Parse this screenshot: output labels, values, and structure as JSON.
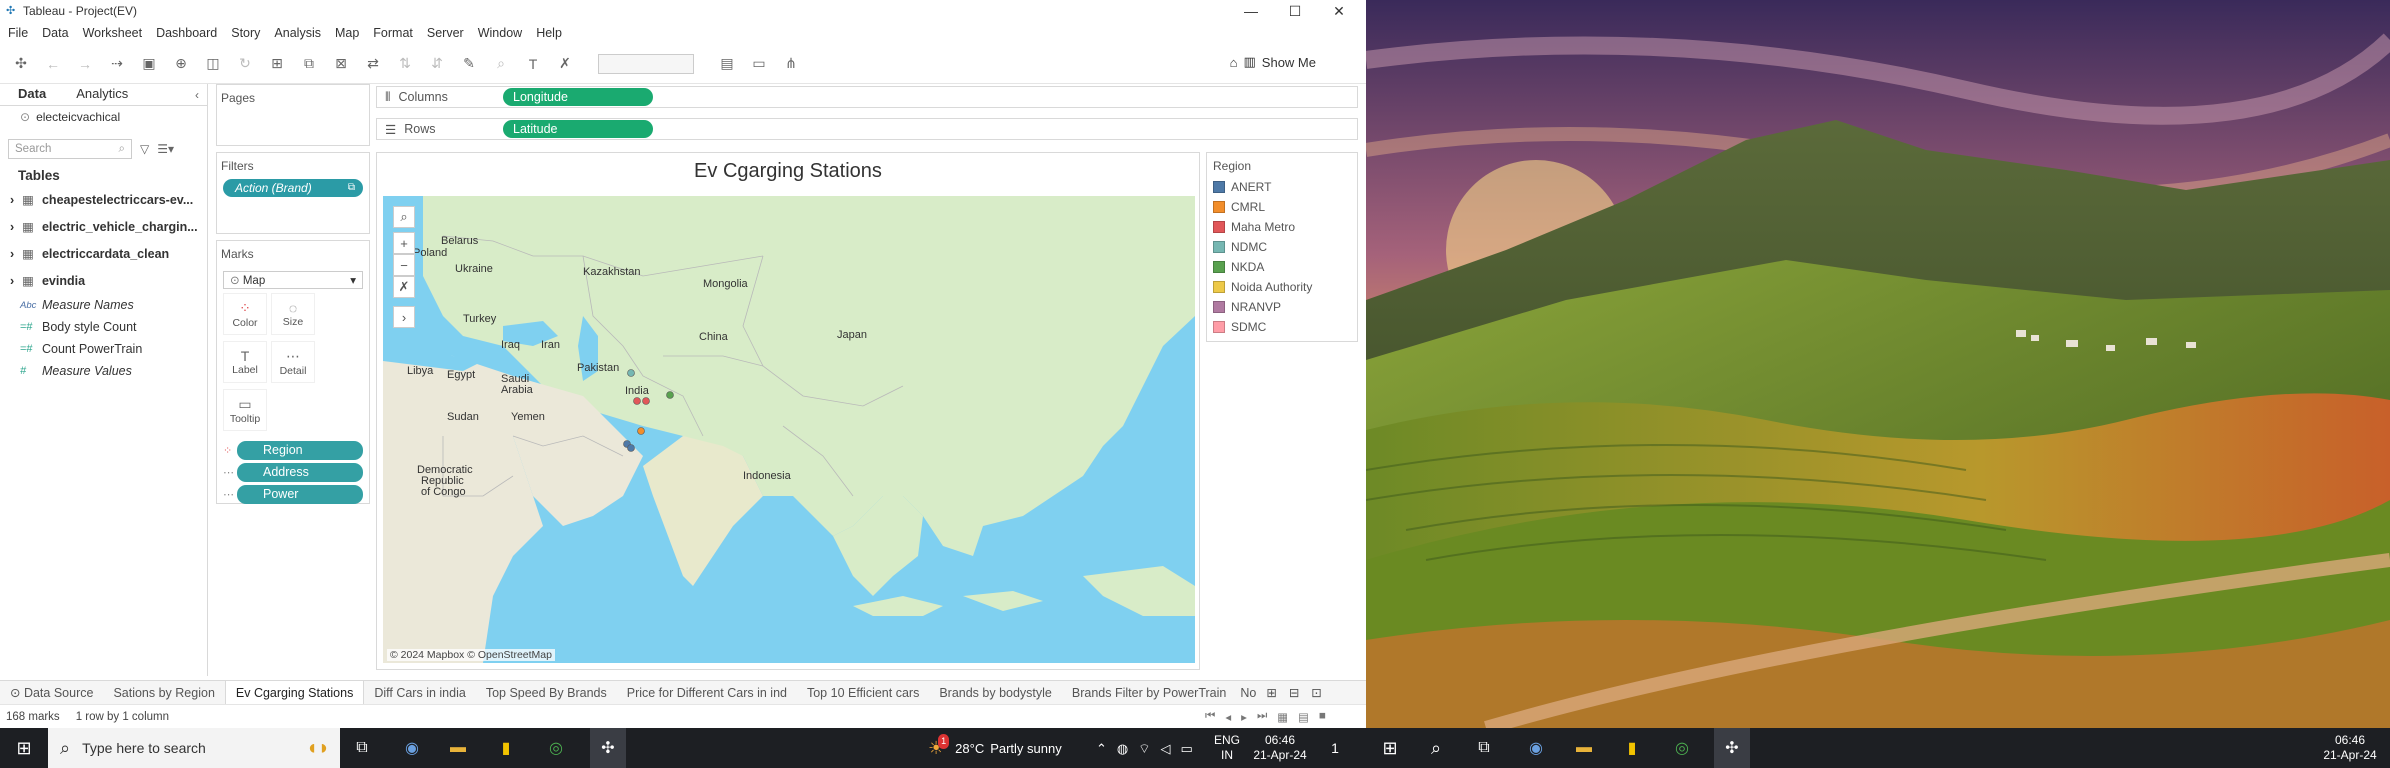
{
  "window": {
    "title": "Tableau - Project(EV)",
    "controls": {
      "minimize": "—",
      "maximize": "☐",
      "close": "✕"
    }
  },
  "menu": [
    "File",
    "Data",
    "Worksheet",
    "Dashboard",
    "Story",
    "Analysis",
    "Map",
    "Format",
    "Server",
    "Window",
    "Help"
  ],
  "toolbar": {
    "show_me": "Show Me"
  },
  "data_pane": {
    "tabs": [
      "Data",
      "Analytics"
    ],
    "datasource": "electeicvachical",
    "search_placeholder": "Search",
    "tables_heading": "Tables",
    "tables": [
      "cheapestelectriccars-ev...",
      "electric_vehicle_chargin...",
      "electriccardata_clean",
      "evindia"
    ],
    "fields": [
      {
        "icon": "Abc",
        "name": "Measure Names",
        "italic": true
      },
      {
        "icon": "=#",
        "name": "Body style Count",
        "italic": false
      },
      {
        "icon": "=#",
        "name": "Count PowerTrain",
        "italic": false
      },
      {
        "icon": "#",
        "name": "Measure Values",
        "italic": true
      }
    ]
  },
  "cards": {
    "pages": "Pages",
    "filters": "Filters",
    "filter_pill": "Action (Brand)",
    "marks": "Marks",
    "mark_type": "Map",
    "mark_buttons": [
      {
        "name": "color",
        "label": "Color",
        "glyph": "⁘"
      },
      {
        "name": "size",
        "label": "Size",
        "glyph": "◌"
      },
      {
        "name": "label",
        "label": "Label",
        "glyph": "T"
      },
      {
        "name": "detail",
        "label": "Detail",
        "glyph": "⋯"
      },
      {
        "name": "tooltip",
        "label": "Tooltip",
        "glyph": "▭"
      }
    ],
    "mark_pills": [
      "Region",
      "Address",
      "Power"
    ]
  },
  "shelves": {
    "columns_label": "Columns",
    "columns_pill": "Longitude",
    "rows_label": "Rows",
    "rows_pill": "Latitude"
  },
  "view": {
    "title": "Ev Cgarging Stations",
    "attribution": "© 2024 Mapbox © OpenStreetMap",
    "map_labels": {
      "poland": "Poland",
      "belarus": "Belarus",
      "ukraine": "Ukraine",
      "kazakhstan": "Kazakhstan",
      "mongolia": "Mongolia",
      "turkey": "Turkey",
      "iraq": "Iraq",
      "iran": "Iran",
      "china": "China",
      "japan": "Japan",
      "libya": "Libya",
      "egypt": "Egypt",
      "saudi1": "Saudi",
      "saudi2": "Arabia",
      "pakistan": "Pakistan",
      "india": "India",
      "sudan": "Sudan",
      "yemen": "Yemen",
      "indonesia": "Indonesia",
      "drc1": "Democratic",
      "drc2": "Republic",
      "drc3": "of Congo"
    }
  },
  "legend": {
    "title": "Region",
    "items": [
      {
        "label": "ANERT",
        "color": "#4e79a7"
      },
      {
        "label": "CMRL",
        "color": "#f28e2b"
      },
      {
        "label": "Maha Metro",
        "color": "#e15759"
      },
      {
        "label": "NDMC",
        "color": "#76b7b2"
      },
      {
        "label": "NKDA",
        "color": "#59a14f"
      },
      {
        "label": "Noida Authority",
        "color": "#edc948"
      },
      {
        "label": "NRANVP",
        "color": "#b07aa1"
      },
      {
        "label": "SDMC",
        "color": "#ff9da7"
      }
    ]
  },
  "sheet_tabs": [
    "Data Source",
    "Sations by Region",
    "Ev Cgarging Stations",
    "Diff Cars in india",
    "Top Speed By Brands",
    "Price for Different Cars in ind",
    "Top 10 Efficient  cars",
    "Brands by bodystyle",
    "Brands Filter by PowerTrain",
    "No"
  ],
  "active_sheet": "Ev Cgarging Stations",
  "status": {
    "marks": "168 marks",
    "rows": "1 row by 1 column"
  },
  "taskbar": {
    "search_placeholder": "Type here to search",
    "weather_temp": "28°C",
    "weather_text": "Partly sunny",
    "weather_badge": "1",
    "lang1": "ENG",
    "lang2": "IN",
    "time": "06:46",
    "date": "21-Apr-24",
    "notif_count": "1",
    "time2": "06:46",
    "date2": "21-Apr-24"
  }
}
